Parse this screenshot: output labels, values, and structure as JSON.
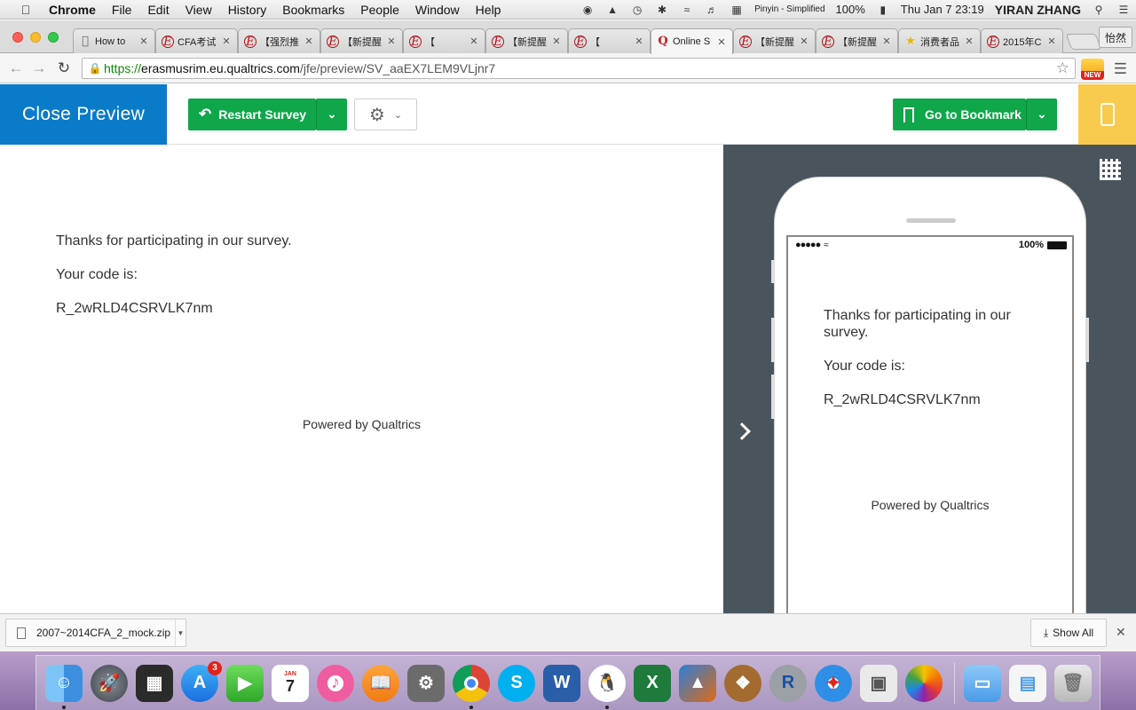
{
  "menubar": {
    "app_name": "Chrome",
    "items": [
      "File",
      "Edit",
      "View",
      "History",
      "Bookmarks",
      "People",
      "Window",
      "Help"
    ],
    "input_method": "Pinyin - Simplified",
    "battery": "100%",
    "datetime": "Thu Jan 7  23:19",
    "user": "YIRAN ZHANG"
  },
  "tabs": [
    {
      "title": "How to",
      "icon": "apple-icon"
    },
    {
      "title": "CFA考试",
      "icon": "e-icon"
    },
    {
      "title": "【强烈推",
      "icon": "e-icon"
    },
    {
      "title": "【新提醒",
      "icon": "e-icon"
    },
    {
      "title": "【",
      "icon": "e-icon"
    },
    {
      "title": "【新提醒",
      "icon": "e-icon"
    },
    {
      "title": "【",
      "icon": "e-icon"
    },
    {
      "title": "Online S",
      "icon": "qualtrics-icon"
    },
    {
      "title": "【新提醒",
      "icon": "e-icon"
    },
    {
      "title": "【新提醒",
      "icon": "e-icon"
    },
    {
      "title": "消费者品",
      "icon": "star-icon"
    },
    {
      "title": "2015年C",
      "icon": "e-icon"
    }
  ],
  "profile_name": "怡然",
  "omnibox": {
    "scheme": "https://",
    "host": "erasmusrim.eu.qualtrics.com",
    "path": "/jfe/preview/SV_aaEX7LEM9VLjnr7"
  },
  "extension_badge": "NEW",
  "header": {
    "close_preview": "Close Preview",
    "restart_survey": "Restart Survey",
    "go_to_bookmark": "Go to Bookmark"
  },
  "survey": {
    "thanks": "Thanks for participating in our survey.",
    "code_label": "Your code is:",
    "code": "R_2wRLD4CSRVLK7nm",
    "powered_by": "Powered by Qualtrics"
  },
  "mobile": {
    "battery": "100%",
    "thanks": "Thanks for participating in our survey.",
    "code_label": "Your code is:",
    "code": "R_2wRLD4CSRVLK7nm",
    "powered_by": "Powered by Qualtrics"
  },
  "download_shelf": {
    "file_name": "2007~2014CFA_2_mock.zip",
    "show_all": "Show All"
  },
  "dock": {
    "app_store_badge": "3",
    "calendar_month": "JAN",
    "calendar_day": "7"
  },
  "colors": {
    "close_preview_bg": "#0a7bc8",
    "primary_green": "#10a64a",
    "mobile_toggle": "#f8cb4f",
    "mobile_pane_bg": "#4a545c"
  }
}
